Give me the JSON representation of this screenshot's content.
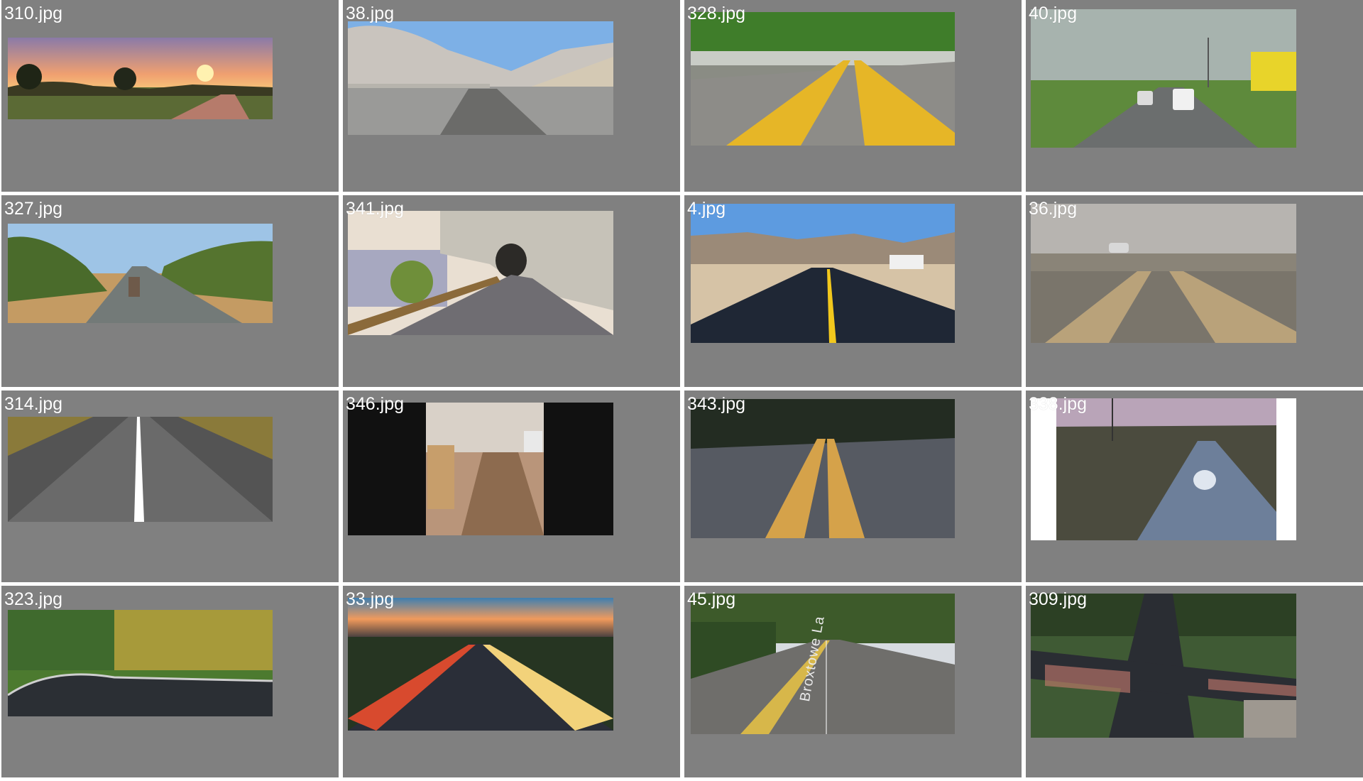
{
  "thumbnails": [
    {
      "filename": "310.jpg",
      "scene": "sunset-country-road"
    },
    {
      "filename": "38.jpg",
      "scene": "desert-mountain-gravel-road"
    },
    {
      "filename": "328.jpg",
      "scene": "double-yellow-line-closeup"
    },
    {
      "filename": "40.jpg",
      "scene": "town-road-with-vans"
    },
    {
      "filename": "327.jpg",
      "scene": "outback-highway-truck"
    },
    {
      "filename": "341.jpg",
      "scene": "cliff-tunnel-road"
    },
    {
      "filename": "4.jpg",
      "scene": "desert-construction-highway"
    },
    {
      "filename": "36.jpg",
      "scene": "blurred-road-closeup-car"
    },
    {
      "filename": "314.jpg",
      "scene": "asphalt-white-line"
    },
    {
      "filename": "346.jpg",
      "scene": "damaged-street-portrait"
    },
    {
      "filename": "343.jpg",
      "scene": "cracked-yellow-lines"
    },
    {
      "filename": "338.jpg",
      "scene": "wet-road-power-lines"
    },
    {
      "filename": "323.jpg",
      "scene": "autumn-curve-road"
    },
    {
      "filename": "33.jpg",
      "scene": "light-trails-highway"
    },
    {
      "filename": "45.jpg",
      "scene": "broxtowe-street"
    },
    {
      "filename": "309.jpg",
      "scene": "aerial-intersection"
    }
  ],
  "street_marking": "Broxtowe La",
  "colors": {
    "tile_bg": "#808080",
    "label": "#ffffff"
  }
}
